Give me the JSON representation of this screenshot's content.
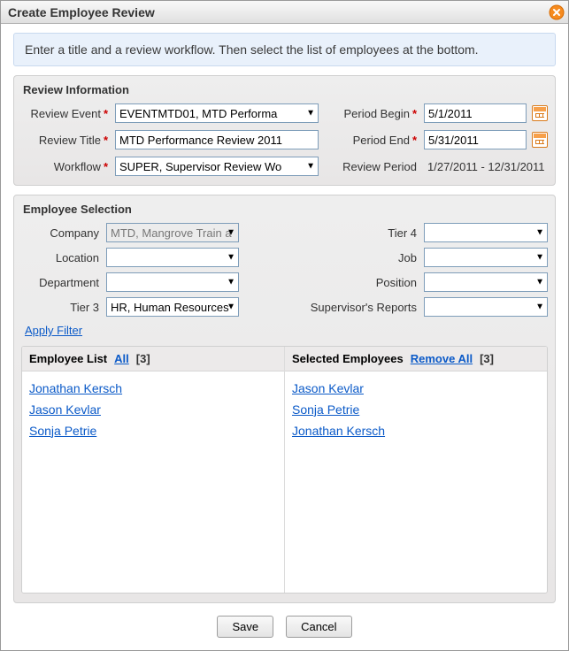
{
  "window": {
    "title": "Create Employee Review"
  },
  "info_banner": "Enter a title and a review workflow. Then select the list of employees at the bottom.",
  "review_info": {
    "section_title": "Review Information",
    "labels": {
      "review_event": "Review Event",
      "review_title": "Review Title",
      "workflow": "Workflow",
      "period_begin": "Period Begin",
      "period_end": "Period End",
      "review_period": "Review Period"
    },
    "values": {
      "review_event": "EVENTMTD01, MTD Performa",
      "review_title": "MTD Performance Review 2011",
      "workflow": "SUPER, Supervisor Review Wo",
      "period_begin": "5/1/2011",
      "period_end": "5/31/2011",
      "review_period": "1/27/2011 - 12/31/2011"
    }
  },
  "employee_selection": {
    "section_title": "Employee Selection",
    "labels": {
      "company": "Company",
      "location": "Location",
      "department": "Department",
      "tier3": "Tier 3",
      "tier4": "Tier 4",
      "job": "Job",
      "position": "Position",
      "supervisors_reports": "Supervisor's Reports"
    },
    "values": {
      "company": "MTD, Mangrove Train a",
      "location": "",
      "department": "",
      "tier3": "HR, Human Resources",
      "tier4": "",
      "job": "",
      "position": "",
      "supervisors_reports": ""
    },
    "apply_filter_label": "Apply Filter"
  },
  "lists": {
    "employee_list": {
      "title": "Employee List",
      "action_label": "All",
      "count": 3,
      "items": [
        "Jonathan Kersch",
        "Jason Kevlar",
        "Sonja Petrie"
      ]
    },
    "selected_employees": {
      "title": "Selected Employees",
      "action_label": "Remove All",
      "count": 3,
      "items": [
        "Jason Kevlar",
        "Sonja Petrie",
        "Jonathan Kersch"
      ]
    }
  },
  "buttons": {
    "save": "Save",
    "cancel": "Cancel"
  }
}
